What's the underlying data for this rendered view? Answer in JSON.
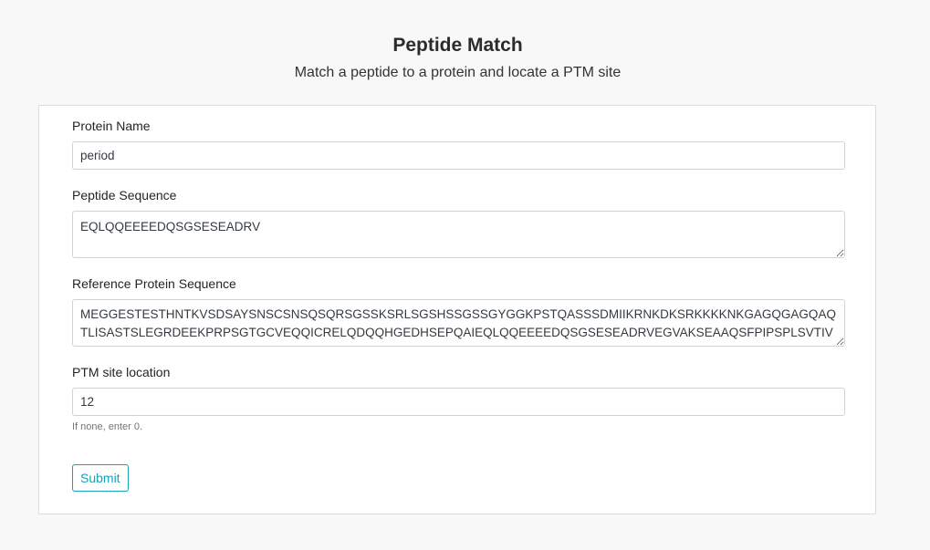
{
  "header": {
    "title": "Peptide Match",
    "subtitle": "Match a peptide to a protein and locate a PTM site"
  },
  "form": {
    "protein_name": {
      "label": "Protein Name",
      "value": "period"
    },
    "peptide_sequence": {
      "label": "Peptide Sequence",
      "value": "EQLQQEEEEDQSGSESEADRV"
    },
    "reference_sequence": {
      "label": "Reference Protein Sequence",
      "value": "MEGGESTESTHNTKVSDSAYSNSCSNSQSQRSGSSKSRLSGSHSSGSSGYGGKPSTQASSSDMIIKRNKDKSRKKKKNKGAGQGAGQAQTLISASTSLEGRDEEKPRPSGTGCVEQQICRELQDQQHGEDHSEPQAIEQLQQEEEEDQSGSESEADRVEGVAKSEAAQSFPIPSPLSVTIVPPS"
    },
    "ptm_site": {
      "label": "PTM site location",
      "value": "12",
      "help": "If none, enter 0."
    },
    "submit_label": "Submit"
  },
  "colors": {
    "accent": "#17a2b8",
    "background": "#f8f8f9",
    "border": "#ced4da"
  }
}
